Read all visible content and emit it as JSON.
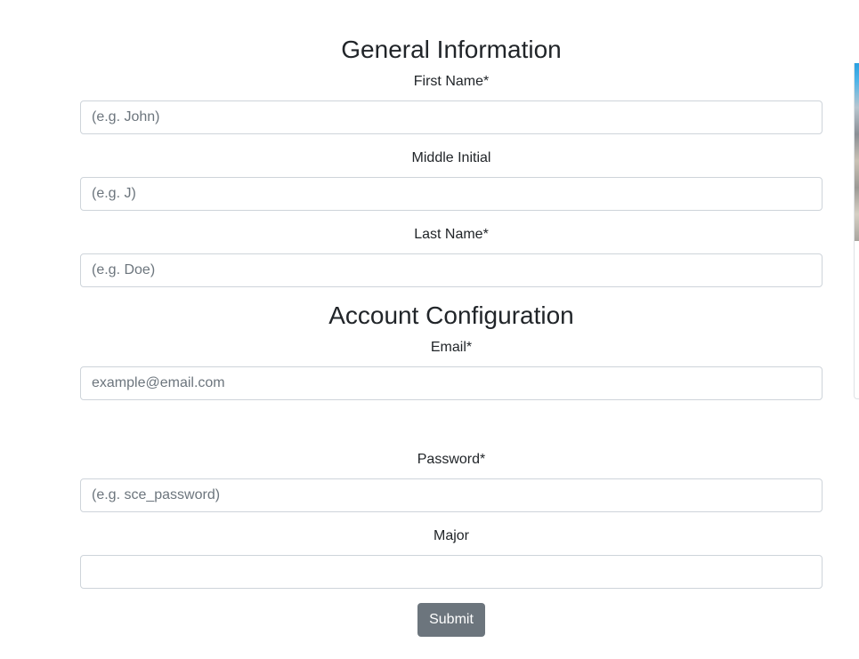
{
  "general": {
    "heading": "General Information",
    "first_name": {
      "label": "First Name*",
      "placeholder": "(e.g. John)",
      "value": ""
    },
    "middle_initial": {
      "label": "Middle Initial",
      "placeholder": "(e.g. J)",
      "value": ""
    },
    "last_name": {
      "label": "Last Name*",
      "placeholder": "(e.g. Doe)",
      "value": ""
    }
  },
  "account": {
    "heading": "Account Configuration",
    "email": {
      "label": "Email*",
      "placeholder": "example@email.com",
      "value": ""
    },
    "password": {
      "label": "Password*",
      "placeholder": "(e.g. sce_password)",
      "value": ""
    },
    "major": {
      "label": "Major",
      "placeholder": "",
      "value": ""
    }
  },
  "submit_label": "Submit",
  "colors": {
    "button_bg": "#6c757d",
    "input_border": "#ced4da",
    "text": "#212529"
  }
}
